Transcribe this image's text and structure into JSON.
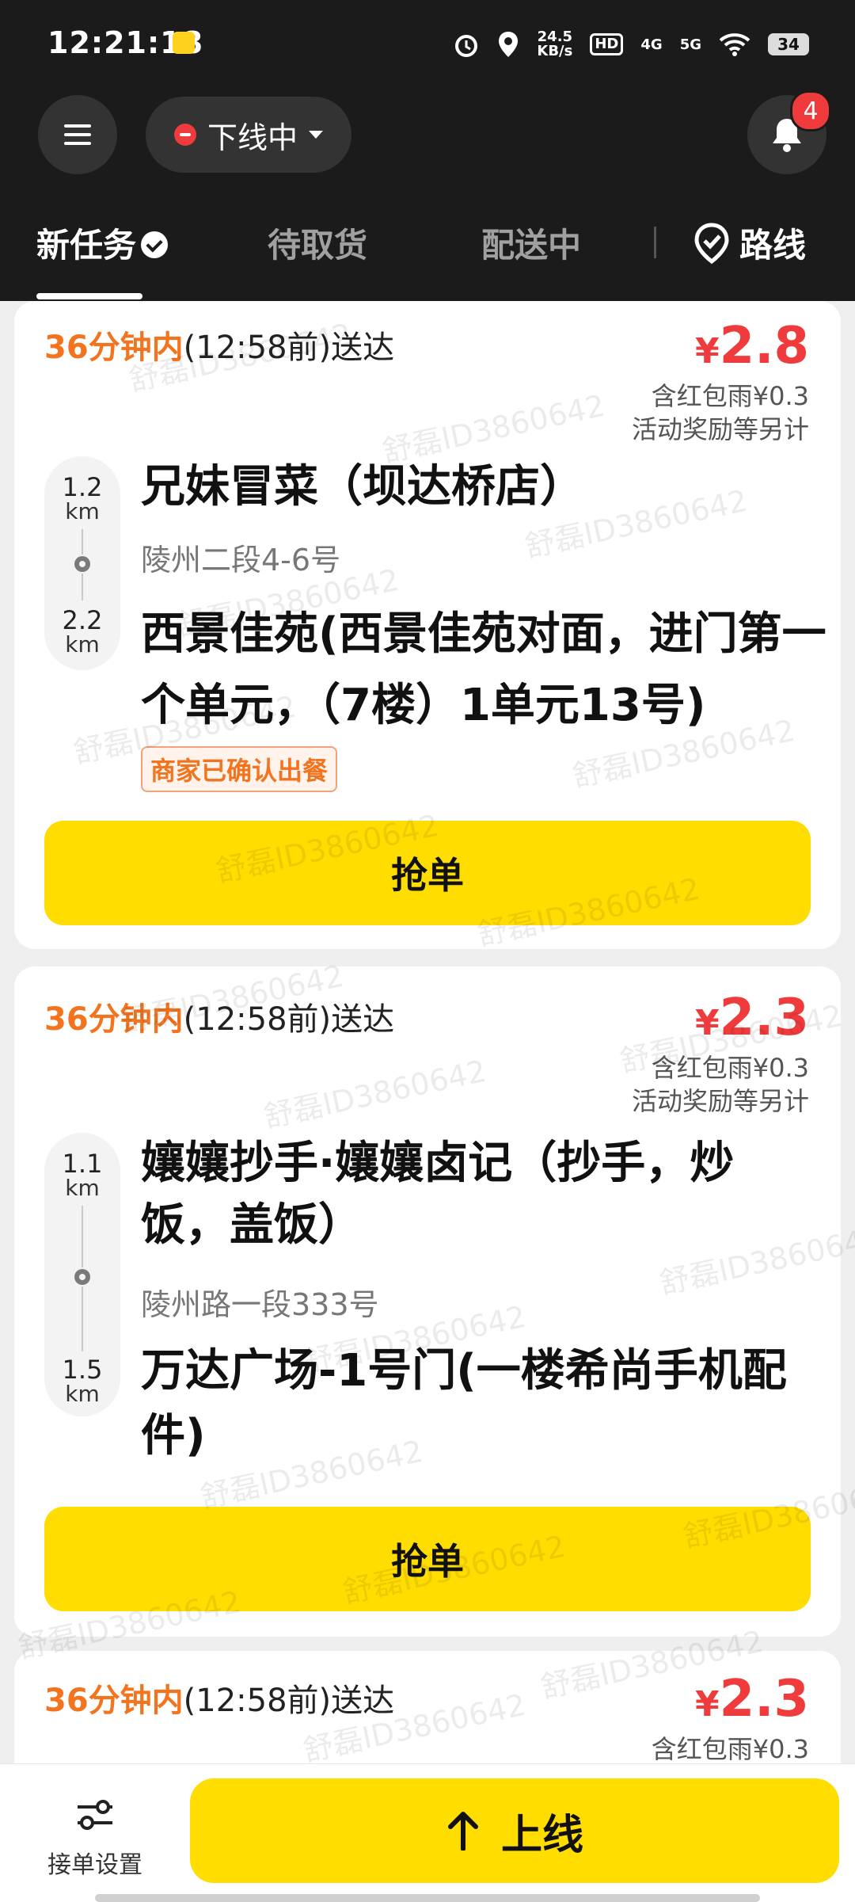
{
  "status_bar": {
    "time": "12:21:18",
    "speed_value": "24.5",
    "speed_unit": "KB/s",
    "hd": "HD",
    "net1": "4G",
    "net2": "5G",
    "battery": "34"
  },
  "header": {
    "status_label": "下线中",
    "notification_count": "4"
  },
  "tabs": [
    {
      "label": "新任务"
    },
    {
      "label": "待取货"
    },
    {
      "label": "配送中"
    }
  ],
  "route_label": "路线",
  "orders": [
    {
      "deadline_highlight": "36分钟内",
      "deadline_rest": "(12:58前)送达",
      "price": "2.8",
      "currency": "¥",
      "red_packet": "含红包雨¥0.3",
      "bonus_note": "活动奖励等另计",
      "pickup_distance": "1.2",
      "dropoff_distance": "2.2",
      "unit": "km",
      "store_name": "兄妹冒菜（坝达桥店）",
      "store_address": "陵州二段4-6号",
      "destination": "西景佳苑(西景佳苑对面，进门第一个单元，（7楼）1单元13号)",
      "tag": "商家已确认出餐",
      "action": "抢单"
    },
    {
      "deadline_highlight": "36分钟内",
      "deadline_rest": "(12:58前)送达",
      "price": "2.3",
      "currency": "¥",
      "red_packet": "含红包雨¥0.3",
      "bonus_note": "活动奖励等另计",
      "pickup_distance": "1.1",
      "dropoff_distance": "1.5",
      "unit": "km",
      "store_name": "孃孃抄手·孃孃卤记（抄手，炒饭，盖饭）",
      "store_address": "陵州路一段333号",
      "destination": "万达广场-1号门(一楼希尚手机配件)",
      "action": "抢单"
    },
    {
      "deadline_highlight": "36分钟内",
      "deadline_rest": "(12:58前)送达",
      "price": "2.3",
      "currency": "¥",
      "red_packet": "含红包雨¥0.3"
    }
  ],
  "watermark": "舒磊ID3860642",
  "bottom": {
    "settings_label": "接单设置",
    "online_label": "上线"
  },
  "colors": {
    "accent_yellow": "#ffdd00",
    "price_red": "#ef3b3b",
    "deadline_orange": "#f2741e",
    "dark_header": "#1b1b1b"
  }
}
